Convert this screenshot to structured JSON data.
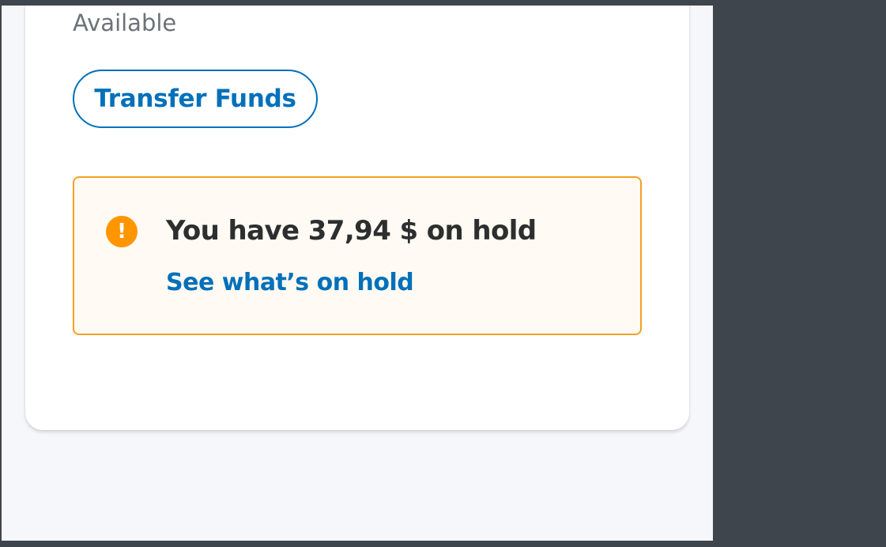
{
  "balance": {
    "available_label": "Available"
  },
  "actions": {
    "transfer_label": "Transfer Funds"
  },
  "hold_notice": {
    "icon": "exclamation-icon",
    "title": "You have 37,94 $ on hold",
    "link_label": "See what’s on hold",
    "icon_color": "#ff9600",
    "border_color": "#f0a224",
    "background_color": "#fffaf3"
  },
  "colors": {
    "accent": "#0070ba",
    "text_primary": "#2c2e2f",
    "text_secondary": "#6c7378",
    "page_background": "#f5f7fa",
    "outer_background": "#3f454c"
  }
}
